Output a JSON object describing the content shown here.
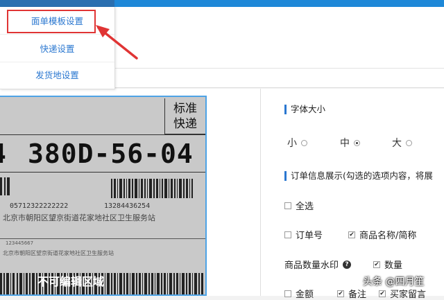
{
  "menu": {
    "items": [
      {
        "label": "面单模板设置",
        "selected": true
      },
      {
        "label": "快递设置"
      },
      {
        "label": "发货地设置"
      }
    ]
  },
  "label_preview": {
    "service_type": "标准\n快递",
    "route_code": "380D-56-04",
    "route_prefix": "4",
    "phone_1": "05712322222222",
    "phone_2": "13284436254",
    "address": "北京市朝阳区望京街道花家地社区卫生服务站",
    "small_1": "123445667",
    "small_2": "北京市朝阳区望京街道花家地社区卫生服务站",
    "non_editable": "不可编辑区域"
  },
  "font_size": {
    "title": "字体大小",
    "options": [
      {
        "label": "小",
        "selected": false
      },
      {
        "label": "中",
        "selected": true
      },
      {
        "label": "大",
        "selected": false
      }
    ]
  },
  "order_info": {
    "title": "订单信息展示(勾选的选项内容，将展",
    "select_all": "全选",
    "order_no": "订单号",
    "product_name": "商品名称/简称",
    "qty_watermark": "商品数量水印",
    "quantity": "数量",
    "amount": "金额",
    "remark": "备注",
    "buyer_message": "买家留言"
  },
  "watermark": "头条 @四月笙",
  "colors": {
    "accent": "#2a77d0",
    "highlight": "#e03434",
    "topbar": "#1e88d8"
  }
}
